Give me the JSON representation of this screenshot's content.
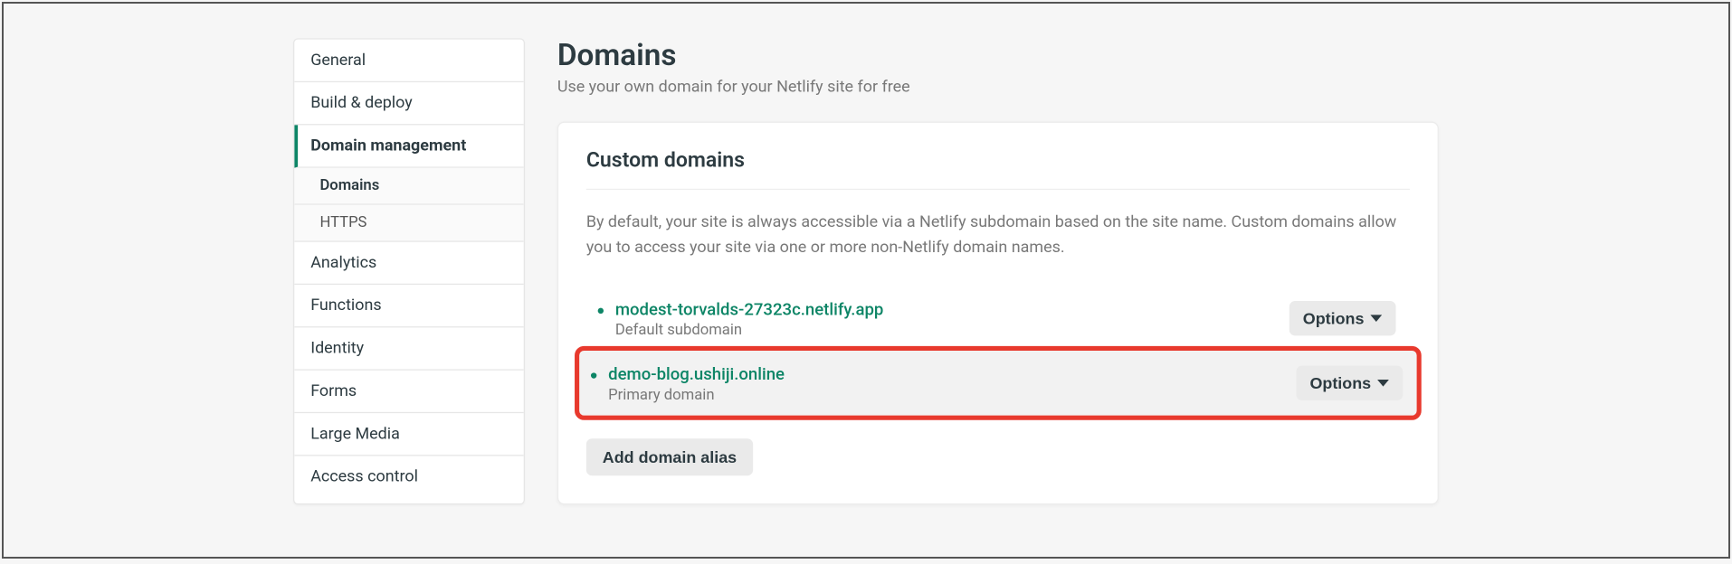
{
  "sidebar": {
    "items": [
      {
        "label": "General"
      },
      {
        "label": "Build & deploy"
      },
      {
        "label": "Domain management",
        "active": true
      },
      {
        "label": "Analytics"
      },
      {
        "label": "Functions"
      },
      {
        "label": "Identity"
      },
      {
        "label": "Forms"
      },
      {
        "label": "Large Media"
      },
      {
        "label": "Access control"
      }
    ],
    "subitems": [
      {
        "label": "Domains",
        "active": true
      },
      {
        "label": "HTTPS"
      }
    ]
  },
  "page": {
    "title": "Domains",
    "subtitle": "Use your own domain for your Netlify site for free"
  },
  "card": {
    "title": "Custom domains",
    "description": "By default, your site is always accessible via a Netlify subdomain based on the site name. Custom domains allow you to access your site via one or more non-Netlify domain names.",
    "domains": [
      {
        "name": "modest-torvalds-27323c.netlify.app",
        "sub": "Default subdomain",
        "options_label": "Options",
        "highlighted": false
      },
      {
        "name": "demo-blog.ushiji.online",
        "sub": "Primary domain",
        "options_label": "Options",
        "highlighted": true
      }
    ],
    "add_button": "Add domain alias"
  }
}
